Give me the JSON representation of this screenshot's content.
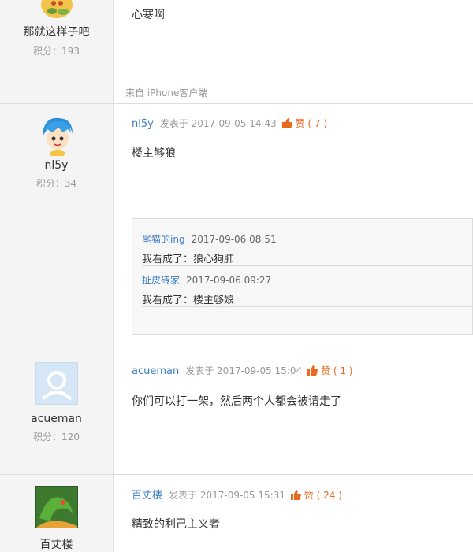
{
  "posts": [
    {
      "username": "那就这样子吧",
      "score_label": "积分：",
      "score": "193",
      "body": "心寒啊",
      "source": "来自 iPhone客户端"
    },
    {
      "username": "nl5y",
      "score_label": "积分：",
      "score": "34",
      "author": "nl5y",
      "posted": "发表于 2017-09-05 14:43",
      "like_label": "赞",
      "like_count": "( 7 )",
      "body": "楼主够狼",
      "replies": [
        {
          "user": "尾猫的ing",
          "date": "2017-09-06 08:51",
          "text": "我看成了：狼心狗肺"
        },
        {
          "user": "扯皮砖家",
          "date": "2017-09-06 09:27",
          "text": "我看成了：楼主够娘"
        }
      ]
    },
    {
      "username": "acueman",
      "score_label": "积分：",
      "score": "120",
      "author": "acueman",
      "posted": "发表于 2017-09-05 15:04",
      "like_label": "赞",
      "like_count": "( 1 )",
      "body": "你们可以打一架，然后两个人都会被请走了"
    },
    {
      "username": "百丈楼",
      "author": "百丈楼",
      "posted": "发表于 2017-09-05 15:31",
      "like_label": "赞",
      "like_count": "( 24 )",
      "body": "精致的利己主义者"
    }
  ],
  "colors": {
    "link": "#3c7dc4",
    "like": "#e76a1e",
    "sidebar": "#f4f4f4"
  },
  "icons": {
    "like": "thumbs-up-icon",
    "avatar": "user-silhouette-icon"
  }
}
